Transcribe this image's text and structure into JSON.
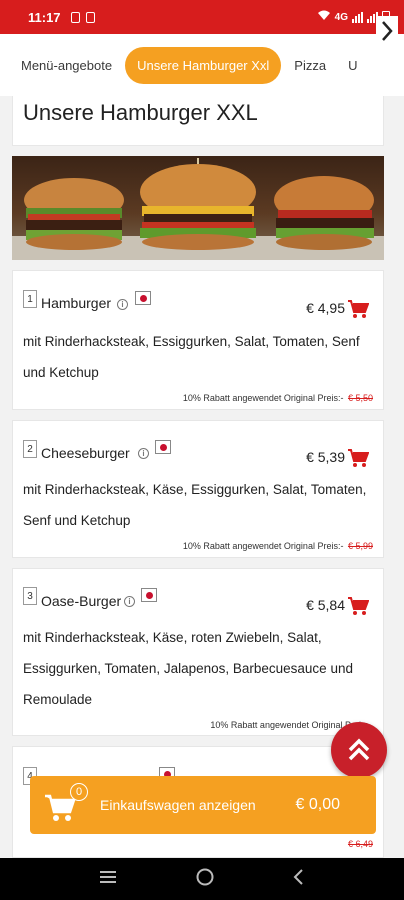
{
  "status_bar": {
    "time": "11:17",
    "network": "4G"
  },
  "tabs": [
    {
      "label": "Menü-angebote",
      "active": false
    },
    {
      "label": "Unsere Hamburger Xxl",
      "active": true
    },
    {
      "label": "Pizza",
      "active": false
    },
    {
      "label": "U",
      "active": false
    }
  ],
  "section_title": "Unsere Hamburger XXL",
  "items": [
    {
      "number": "1",
      "name": "Hamburger",
      "price": "€ 4,95",
      "description": "mit Rinderhacksteak, Essiggurken, Salat, Tomaten, Senf und Ketchup",
      "discount_text": "10% Rabatt angewendet Original Preis:-",
      "original_price": "€ 5,50"
    },
    {
      "number": "2",
      "name": "Cheeseburger",
      "price": "€ 5,39",
      "description": "mit Rinderhacksteak, Käse, Essiggurken, Salat, Tomaten, Senf und Ketchup",
      "discount_text": "10% Rabatt angewendet Original Preis:-",
      "original_price": "€ 5,99"
    },
    {
      "number": "3",
      "name": "Oase-Burger",
      "price": "€ 5,84",
      "description": "mit Rinderhacksteak, Käse, roten Zwiebeln, Salat, Essiggurken, Tomaten, Jalapenos, Barbecuesauce und Remoulade",
      "discount_text": "10% Rabatt angewendet Original Preis:-",
      "original_price": ""
    },
    {
      "number": "4",
      "name": "",
      "price": "",
      "description": "",
      "discount_text": "",
      "original_price": "€ 6,49"
    }
  ],
  "cart": {
    "count": "0",
    "label": "Einkaufswagen anzeigen",
    "total": "€ 0,00"
  },
  "colors": {
    "brand_red": "#d71d1d",
    "accent_orange": "#f5a021"
  }
}
